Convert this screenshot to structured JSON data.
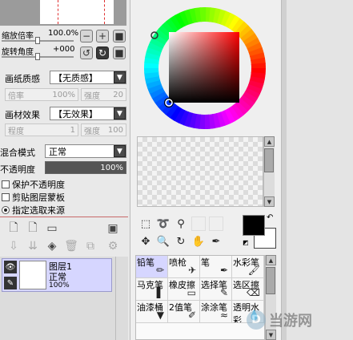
{
  "navigator": {
    "zoom_label": "缩放倍率",
    "zoom_value": "100.0%",
    "rotate_label": "旋转角度",
    "rotate_value": "+000"
  },
  "brush_params": {
    "paper_texture_label": "画纸质感",
    "paper_texture_value": "【无质感】",
    "texture_scale_label": "倍率",
    "texture_scale_value": "100%",
    "texture_strength_label": "强度",
    "texture_strength_value": "20",
    "paper_effect_label": "画材效果",
    "paper_effect_value": "【无效果】",
    "effect_degree_label": "程度",
    "effect_degree_value": "1",
    "effect_strength_label": "强度",
    "effect_strength_value": "100"
  },
  "layer_props": {
    "blend_label": "混合模式",
    "blend_value": "正常",
    "opacity_label": "不透明度",
    "opacity_value": "100%",
    "protect_opacity": "保护不透明度",
    "clip_group": "剪贴图层蒙板",
    "select_source": "指定选取来源"
  },
  "layer": {
    "name": "图层1",
    "mode": "正常",
    "opacity": "100%"
  },
  "tools": [
    {
      "label": "铅笔",
      "icon": "pencil-icon",
      "selected": true
    },
    {
      "label": "喷枪",
      "icon": "airbrush-icon",
      "selected": false
    },
    {
      "label": "笔",
      "icon": "brush-icon",
      "selected": false
    },
    {
      "label": "水彩笔",
      "icon": "watercolor-icon",
      "selected": false
    },
    {
      "label": "马克笔",
      "icon": "marker-icon",
      "selected": false
    },
    {
      "label": "橡皮擦",
      "icon": "eraser-icon",
      "selected": false
    },
    {
      "label": "选择笔",
      "icon": "select-pen-icon",
      "selected": false
    },
    {
      "label": "选区擦",
      "icon": "select-eraser-icon",
      "selected": false
    },
    {
      "label": "油漆桶",
      "icon": "bucket-icon",
      "selected": false
    },
    {
      "label": "2值笔",
      "icon": "binary-pen-icon",
      "selected": false
    },
    {
      "label": "涂涂笔",
      "icon": "smudge-icon",
      "selected": false
    },
    {
      "label": "透明水彩",
      "icon": "transparent-watercolor-icon",
      "selected": false
    }
  ],
  "colors": {
    "foreground": "#000000",
    "background": "#ffffff",
    "layer_selected": "#d6d6ff",
    "selected_tool": "#d6d6ff"
  },
  "watermark": "当游网"
}
